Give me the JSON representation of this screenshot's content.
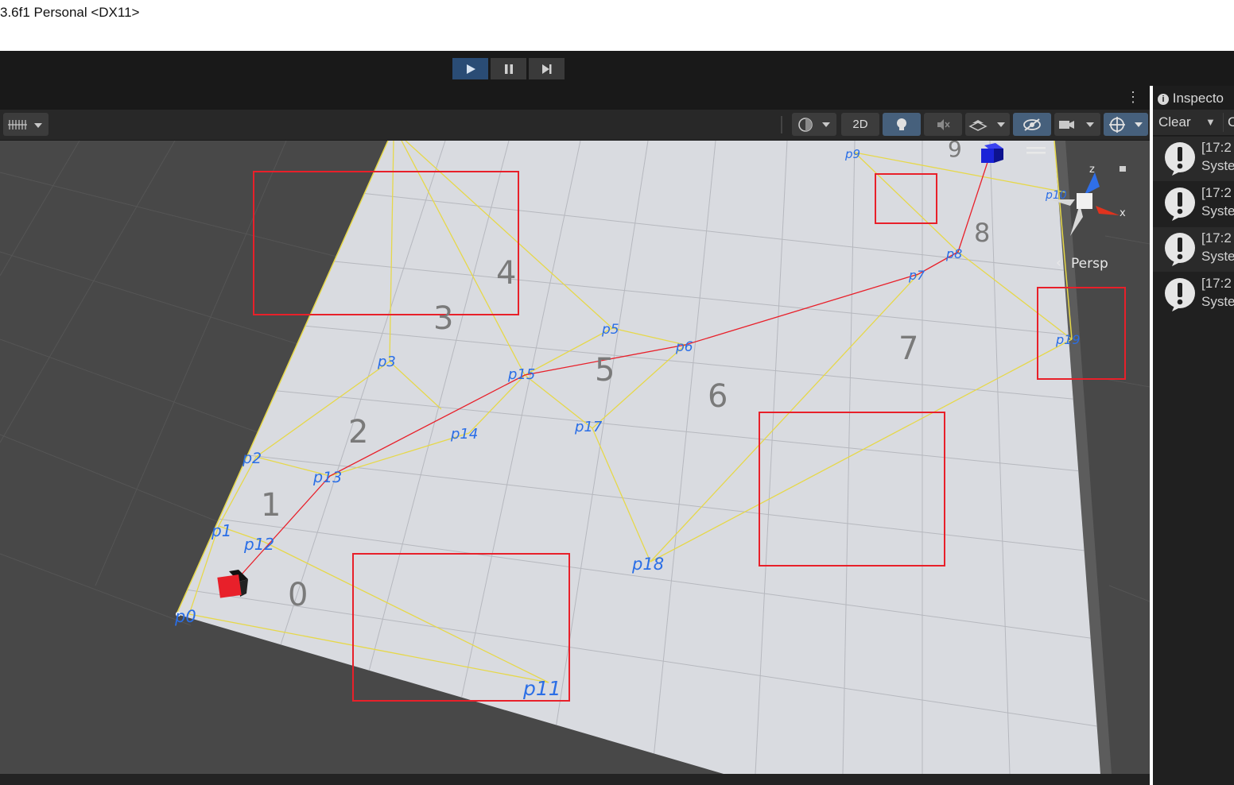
{
  "window": {
    "title": "3.6f1 Personal <DX11>"
  },
  "playbar": {
    "play": "play-icon",
    "pause": "pause-icon",
    "step": "step-icon",
    "playing": true
  },
  "toolbar": {
    "mode_2d": "2D",
    "lighting_on": true,
    "gizmos_on": true
  },
  "scene": {
    "view_label": "Persp",
    "axis_x": "x",
    "axis_z": "z",
    "region_numbers": [
      "0",
      "1",
      "2",
      "3",
      "4",
      "5",
      "6",
      "7",
      "8",
      "9"
    ],
    "points": [
      {
        "id": "p0",
        "label": "p0"
      },
      {
        "id": "p1",
        "label": "p1"
      },
      {
        "id": "p2",
        "label": "p2"
      },
      {
        "id": "p3",
        "label": "p3"
      },
      {
        "id": "p5",
        "label": "p5"
      },
      {
        "id": "p6",
        "label": "p6"
      },
      {
        "id": "p7",
        "label": "p7"
      },
      {
        "id": "p8",
        "label": "p8"
      },
      {
        "id": "p9",
        "label": "p9"
      },
      {
        "id": "p10",
        "label": "p10"
      },
      {
        "id": "p11",
        "label": "p11"
      },
      {
        "id": "p12",
        "label": "p12"
      },
      {
        "id": "p13",
        "label": "p13"
      },
      {
        "id": "p14",
        "label": "p14"
      },
      {
        "id": "p15",
        "label": "p15"
      },
      {
        "id": "p17",
        "label": "p17"
      },
      {
        "id": "p18",
        "label": "p18"
      },
      {
        "id": "p19",
        "label": "p19"
      }
    ],
    "start_cube_color": "#e8202a",
    "goal_cube_color": "#1a23d8",
    "path_color": "#e8202a",
    "mesh_edge_color": "#e6d84a",
    "label_color": "#2a6ee6",
    "highlight_box_color": "#e8202a"
  },
  "inspector": {
    "tab_label": "Inspecto",
    "clear_label": "Clear",
    "more_label": "C",
    "logs": [
      {
        "time": "[17:2",
        "message": "Syste"
      },
      {
        "time": "[17:2",
        "message": "Syste"
      },
      {
        "time": "[17:2",
        "message": "Syste"
      },
      {
        "time": "[17:2",
        "message": "Syste"
      }
    ]
  }
}
